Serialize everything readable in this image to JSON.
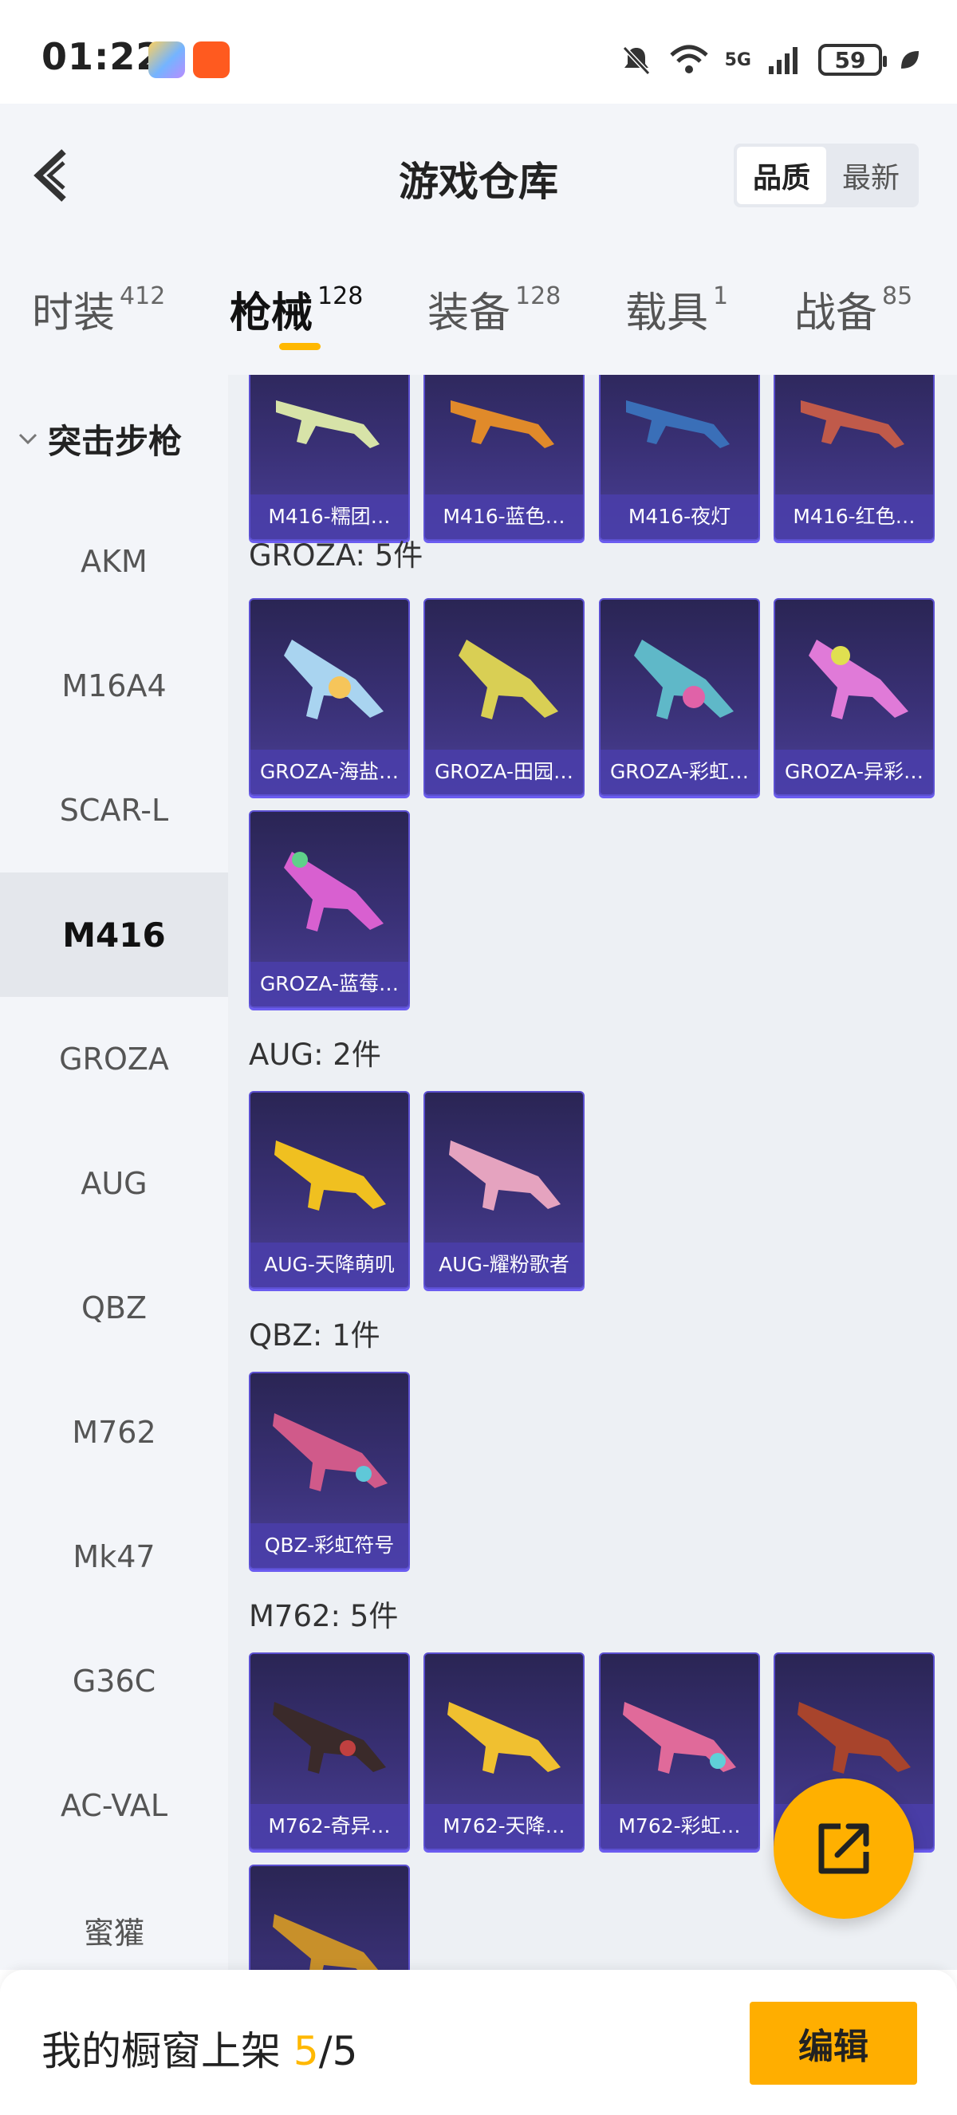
{
  "status_bar": {
    "time": "01:22",
    "battery": "59",
    "network": "5G"
  },
  "header": {
    "title": "游戏仓库",
    "sort_options": [
      "品质",
      "最新"
    ],
    "active_sort": "品质"
  },
  "tabs": [
    {
      "label": "时装",
      "count": "412"
    },
    {
      "label": "枪械",
      "count": "128"
    },
    {
      "label": "装备",
      "count": "128"
    },
    {
      "label": "载具",
      "count": "1"
    },
    {
      "label": "战备",
      "count": "85"
    }
  ],
  "active_tab": "枪械",
  "sidebar": {
    "category": "突击步枪",
    "items": [
      "AKM",
      "M16A4",
      "SCAR-L",
      "M416",
      "GROZA",
      "AUG",
      "QBZ",
      "M762",
      "Mk47",
      "G36C",
      "AC-VAL",
      "蜜獾"
    ],
    "active_item": "M416"
  },
  "sections": {
    "m416": {
      "items": [
        "M416-糯团…",
        "M416-蓝色…",
        "M416-夜灯",
        "M416-红色…"
      ]
    },
    "groza": {
      "label": "GROZA: 5件",
      "items": [
        "GROZA-海盐…",
        "GROZA-田园…",
        "GROZA-彩虹…",
        "GROZA-异彩…",
        "GROZA-蓝莓…"
      ]
    },
    "aug": {
      "label": "AUG: 2件",
      "items": [
        "AUG-天降萌叽",
        "AUG-耀粉歌者"
      ]
    },
    "qbz": {
      "label": "QBZ: 1件",
      "items": [
        "QBZ-彩虹符号"
      ]
    },
    "m762": {
      "label": "M762: 5件",
      "items": [
        "M762-奇异…",
        "M762-天降…",
        "M762-彩虹…",
        ""
      ]
    }
  },
  "bottom_bar": {
    "prefix": "我的橱窗上架 ",
    "current": "5",
    "total": "/5",
    "edit_label": "编辑"
  },
  "colors": {
    "accent": "#ffb800",
    "card_bg": "#3a3177",
    "card_border": "#5b4fd0"
  }
}
